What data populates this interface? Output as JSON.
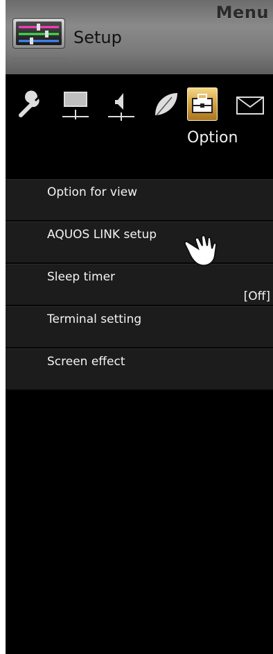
{
  "header": {
    "menu_label": "Menu",
    "title": "Setup",
    "icon": "sliders-icon"
  },
  "categories": [
    {
      "name": "Setup",
      "icon": "wrench-icon",
      "active": false
    },
    {
      "name": "Picture",
      "icon": "monitor-icon",
      "active": false
    },
    {
      "name": "Audio",
      "icon": "speaker-icon",
      "active": false
    },
    {
      "name": "Power",
      "icon": "leaf-icon",
      "active": false
    },
    {
      "name": "Option",
      "icon": "toolbox-icon",
      "active": true
    },
    {
      "name": "Mail",
      "icon": "envelope-icon",
      "active": false
    }
  ],
  "active_category_label": "Option",
  "menu_items": [
    {
      "label": "Option for view",
      "value": ""
    },
    {
      "label": "AQUOS LINK setup",
      "value": ""
    },
    {
      "label": "Sleep timer",
      "value": "[Off]"
    },
    {
      "label": "Terminal setting",
      "value": ""
    },
    {
      "label": "Screen effect",
      "value": ""
    }
  ],
  "cursor_icon": "hand-pointer-icon",
  "colors": {
    "active_tab": "#d2a040",
    "list_bg": "#1c1c1c",
    "panel_bg": "#000000"
  }
}
